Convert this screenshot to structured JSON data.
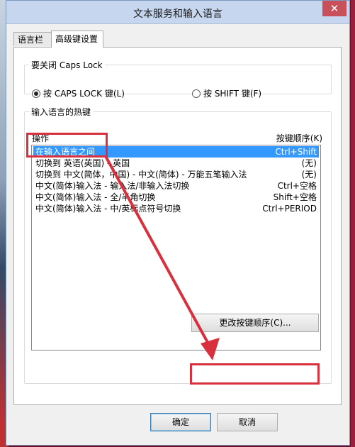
{
  "window": {
    "title": "文本服务和输入语言",
    "close_glyph": "✕"
  },
  "tabs": [
    {
      "label": "语言栏"
    },
    {
      "label": "高级键设置"
    }
  ],
  "caps_lock": {
    "legend": "要关闭 Caps Lock",
    "option_caps": "按 CAPS LOCK 键(L)",
    "option_shift": "按 SHIFT 键(F)",
    "selected": "caps"
  },
  "hotkeys": {
    "legend": "输入语言的热键",
    "col_action": "操作",
    "col_sequence": "按键顺序(K)",
    "rows": [
      {
        "action": "在输入语言之间",
        "keys": "Ctrl+Shift",
        "selected": true
      },
      {
        "action": "切换到 英语(英国) - 英国",
        "keys": "(无)"
      },
      {
        "action": "切换到 中文(简体，中国) - 中文(简体) - 万能五笔输入法",
        "keys": "(无)"
      },
      {
        "action": "中文(简体)输入法 - 输入法/非输入法切换",
        "keys": "Ctrl+空格"
      },
      {
        "action": "中文(简体)输入法 - 全/半角切换",
        "keys": "Shift+空格"
      },
      {
        "action": "中文(简体)输入法 - 中/英标点符号切换",
        "keys": "Ctrl+PERIOD"
      }
    ],
    "change_button": "更改按键顺序(C)..."
  },
  "footer": {
    "ok": "确定",
    "cancel": "取消"
  },
  "annotation": {
    "color": "#d9303e"
  }
}
